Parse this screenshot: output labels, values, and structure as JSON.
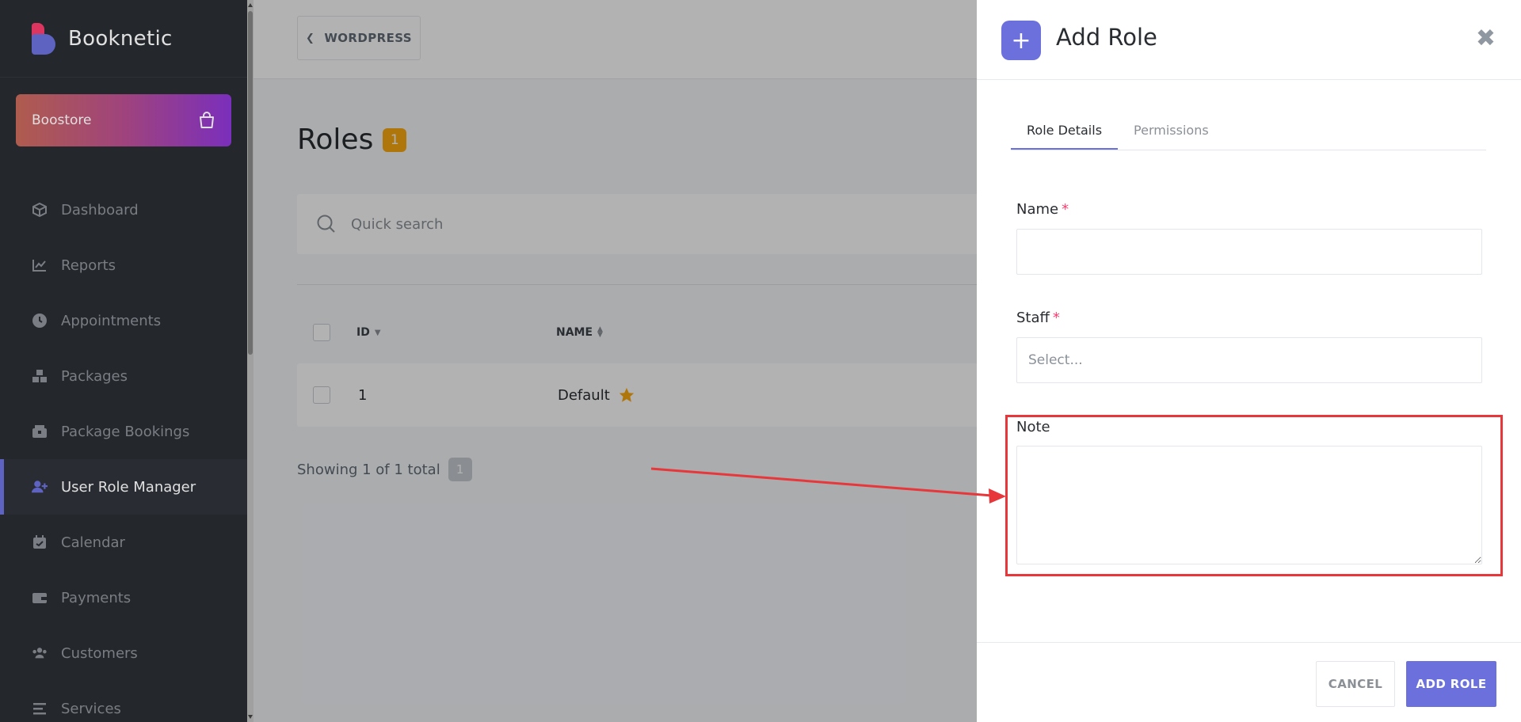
{
  "app": {
    "brand": "Booknetic",
    "boostore_label": "Boostore"
  },
  "sidebar": {
    "items": [
      {
        "label": "Dashboard",
        "icon": "dashboard-icon",
        "active": false
      },
      {
        "label": "Reports",
        "icon": "reports-chart-icon",
        "active": false
      },
      {
        "label": "Appointments",
        "icon": "clock-icon",
        "active": false
      },
      {
        "label": "Packages",
        "icon": "packages-icon",
        "active": false
      },
      {
        "label": "Package Bookings",
        "icon": "package-bookings-icon",
        "active": false
      },
      {
        "label": "User Role Manager",
        "icon": "user-plus-icon",
        "active": true
      },
      {
        "label": "Calendar",
        "icon": "calendar-icon",
        "active": false
      },
      {
        "label": "Payments",
        "icon": "wallet-icon",
        "active": false
      },
      {
        "label": "Customers",
        "icon": "users-icon",
        "active": false
      },
      {
        "label": "Services",
        "icon": "list-icon",
        "active": false
      }
    ]
  },
  "main": {
    "back_button": "WORDPRESS",
    "title": "Roles",
    "count": "1",
    "search_placeholder": "Quick search",
    "columns": [
      "ID",
      "NAME"
    ],
    "rows": [
      {
        "id": "1",
        "name": "Default",
        "starred": true
      }
    ],
    "showing_text": "Showing 1 of 1 total",
    "page": "1"
  },
  "panel": {
    "title": "Add Role",
    "tabs": [
      {
        "label": "Role Details",
        "active": true
      },
      {
        "label": "Permissions",
        "active": false
      }
    ],
    "fields": {
      "name_label": "Name",
      "name_value": "",
      "staff_label": "Staff",
      "staff_placeholder": "Select...",
      "note_label": "Note",
      "note_value": "",
      "required_mark": "*"
    },
    "cancel_label": "CANCEL",
    "add_label": "ADD ROLE"
  },
  "colors": {
    "accent": "#6c70dc",
    "sidebar_bg": "#292d32",
    "badge_orange": "#fba911",
    "highlight_red": "#e8373a",
    "required_red": "#fb3e6e"
  }
}
